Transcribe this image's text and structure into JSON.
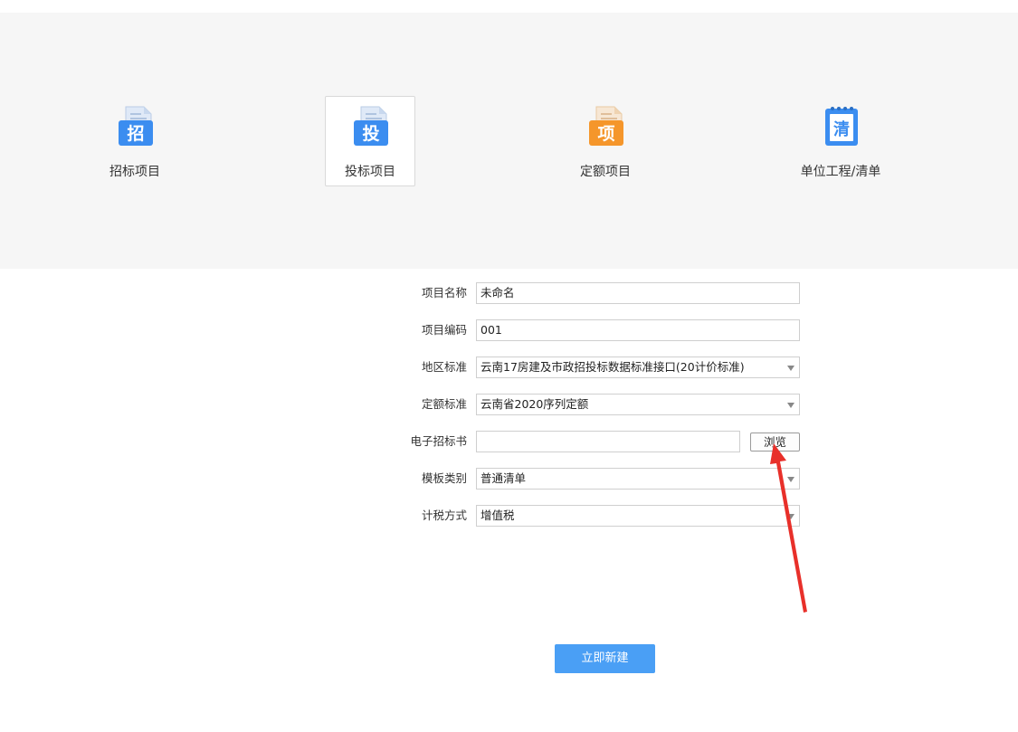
{
  "project_types": [
    {
      "label": "招标项目",
      "icon_char": "招",
      "icon": "zhao-file-icon",
      "color": "#3b8df0",
      "selected": false
    },
    {
      "label": "投标项目",
      "icon_char": "投",
      "icon": "tou-file-icon",
      "color": "#3b8df0",
      "selected": true
    },
    {
      "label": "定额项目",
      "icon_char": "项",
      "icon": "xiang-file-icon",
      "color": "#f5962b",
      "selected": false
    },
    {
      "label": "单位工程/清单",
      "icon_char": "清",
      "icon": "qing-notebook-icon",
      "color": "#3b8df0",
      "selected": false
    }
  ],
  "form": {
    "project_name": {
      "label": "项目名称",
      "value": "未命名"
    },
    "project_code": {
      "label": "项目编码",
      "value": "001"
    },
    "region_standard": {
      "label": "地区标准",
      "value": "云南17房建及市政招投标数据标准接口(20计价标准)"
    },
    "quota_standard": {
      "label": "定额标准",
      "value": "云南省2020序列定额"
    },
    "tender_doc": {
      "label": "电子招标书",
      "value": "",
      "browse_label": "浏览"
    },
    "template_type": {
      "label": "模板类别",
      "value": "普通清单"
    },
    "tax_method": {
      "label": "计税方式",
      "value": "增值税"
    }
  },
  "create_button": {
    "label": "立即新建"
  },
  "annotation": {
    "arrow_color": "#e8302a"
  }
}
